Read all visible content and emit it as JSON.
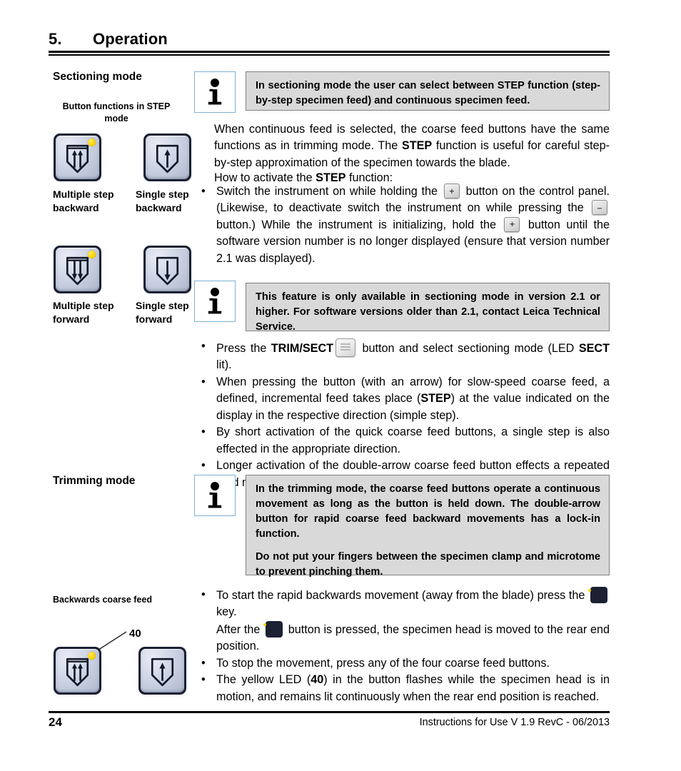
{
  "header": {
    "chapter_number": "5.",
    "chapter_title": "Operation"
  },
  "left_column": {
    "sectioning_heading": "Sectioning mode",
    "step_mode_caption": "Button functions in STEP mode",
    "button_labels": {
      "multiple_step_backward": "Multiple step backward",
      "single_step_backward": "Single step backward",
      "multiple_step_forward": "Multiple step forward",
      "single_step_forward": "Single step forward"
    },
    "trimming_heading": "Trimming mode",
    "backwards_caption": "Backwards coarse feed",
    "callout_number": "40"
  },
  "info_boxes": {
    "sectioning": [
      "In sectioning mode the user can select between STEP function (step-by-step specimen feed) and continuous specimen feed."
    ],
    "version": [
      "This feature is only available in sectioning mode in version 2.1 or higher. For software versions older than 2.1, contact Leica Technical Service."
    ],
    "trimming": [
      "In the trimming mode, the coarse feed buttons operate a continuous movement as long as the button is held down. The double-arrow button for rapid coarse feed backward movements has a lock-in function.",
      "Do not put your fingers between the specimen clamp and microtome to prevent pinching them."
    ]
  },
  "body": {
    "paragraph_1_part_1": "When continuous feed is selected, the coarse feed buttons have the same functions as in trimming mode. The ",
    "paragraph_1_bold": "STEP",
    "paragraph_1_part_2": " function is useful for careful step-by-step approximation of the specimen towards the blade.",
    "paragraph_2_part_1": "How to activate the ",
    "paragraph_2_bold": "STEP",
    "paragraph_2_part_2": " function:",
    "bullet_step": {
      "seg_1": "Switch the instrument on while holding the ",
      "seg_2": " button on the control panel. (Likewise, to deactivate switch the instrument on while pressing the ",
      "seg_3": " button.) While the instrument is initializing, hold the ",
      "seg_4": " button until the software version number is no longer displayed (ensure that version number 2.1 was displayed)."
    },
    "bullets_sectioning": {
      "b1_seg1": "Press the ",
      "b1_bold": "TRIM/SECT",
      "b1_seg2": " button and select sectioning mode (LED ",
      "b1_bold2": "SECT",
      "b1_seg3": " lit).",
      "b2_seg1": "When pressing the button (with an arrow) for slow-speed coarse feed, a defined, incremental feed takes place (",
      "b2_bold": "STEP",
      "b2_seg2": ") at the value indicated on the display in the respective direction (simple step).",
      "b3": "By short activation of the quick coarse feed buttons, a single step is also effected in the appropriate direction.",
      "b4": "Longer activation of the double-arrow coarse feed button effects a repeated feed motion for as long as the button is pressed."
    },
    "bullets_backwards": {
      "b1_seg1": "To start the rapid backwards movement (away from the blade) press the ",
      "b1_seg2": " key.",
      "b1_sub_seg1": "After the ",
      "b1_sub_seg2": " button is pressed, the specimen head is moved to the rear end position.",
      "b2": "To stop the movement, press any of the four coarse feed buttons.",
      "b3_seg1": "The yellow LED (",
      "b3_bold": "40",
      "b3_seg2": ") in the button flashes while the specimen head is in motion, and remains lit continuously when the rear end position is reached."
    },
    "bullet_char": "•",
    "key_plus": "+",
    "key_minus": "–"
  },
  "footer": {
    "page_number": "24",
    "doc_info": "Instructions for Use V 1.9 RevC - 06/2013"
  },
  "colors": {
    "info_box_bg": "#d9d9d9",
    "info_box_border": "#808080",
    "info_icon_border": "#7fb0d6",
    "button_body": "#1b2133",
    "button_face": "#ccd3e4",
    "led_yellow": "#ffd400",
    "rule": "#000000"
  }
}
